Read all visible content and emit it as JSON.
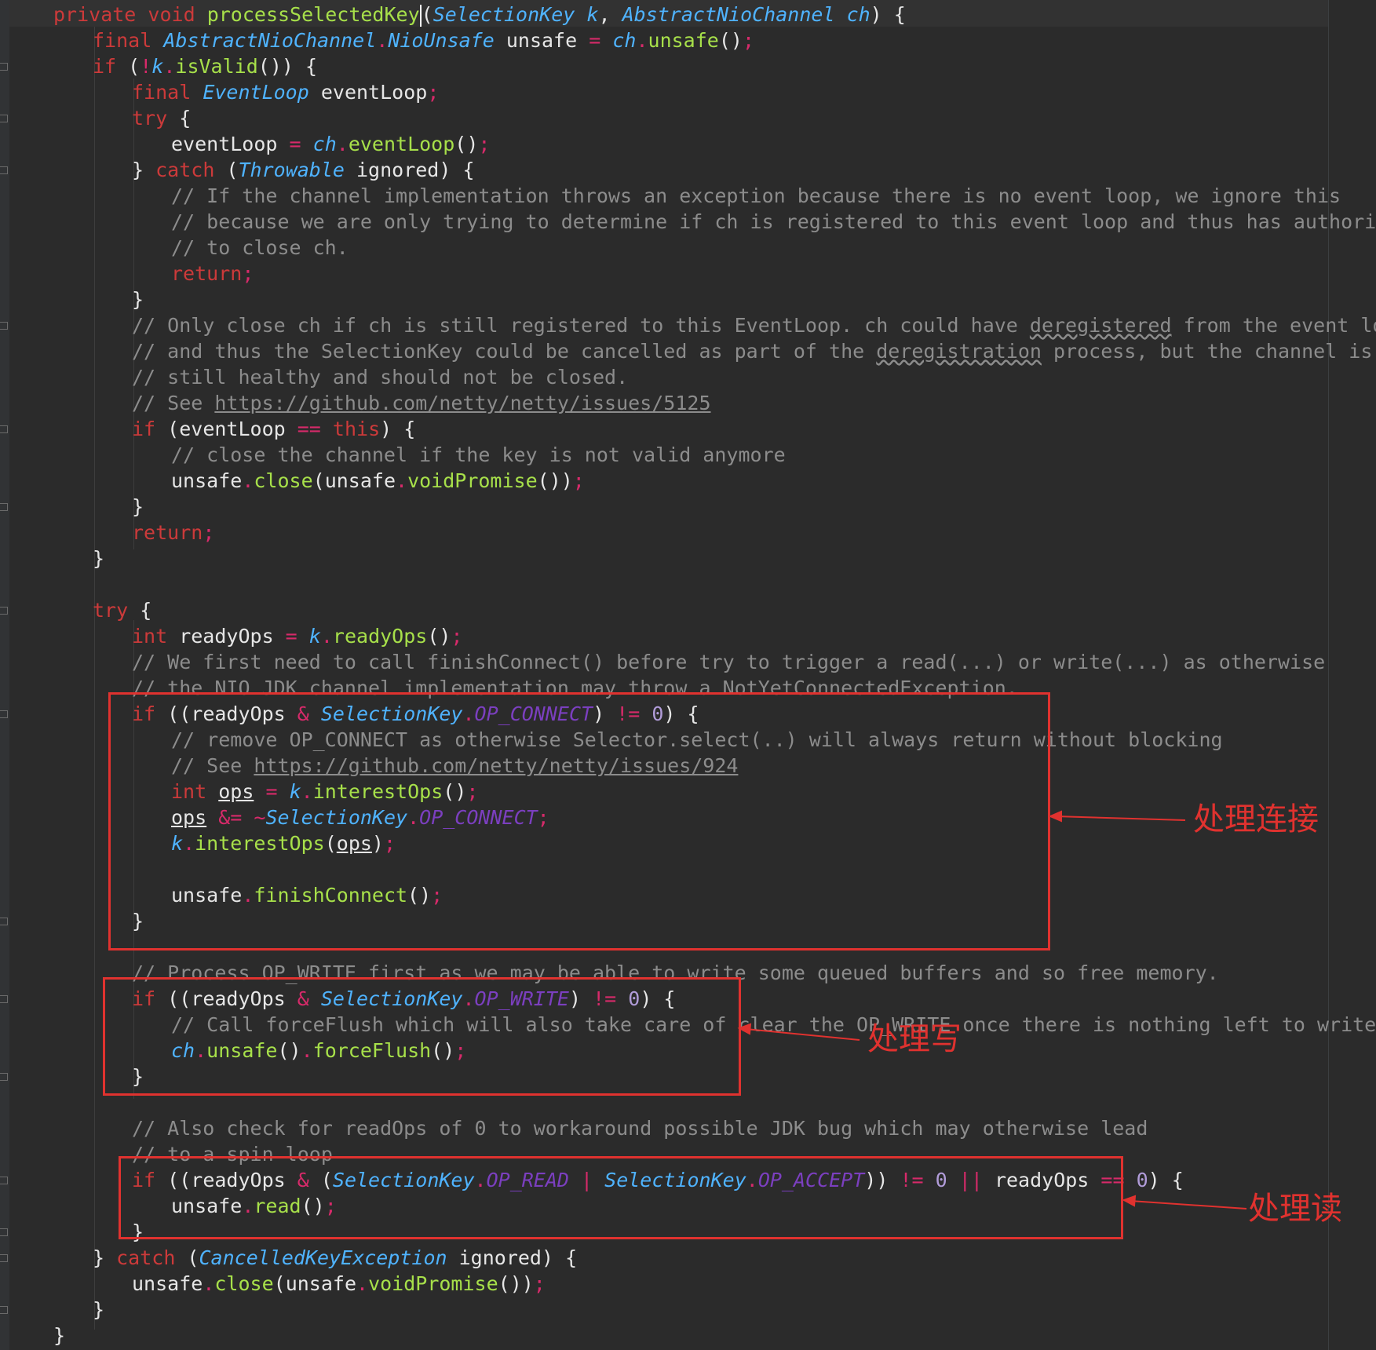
{
  "editor": {
    "lines": [
      [
        "private void processSelectedKey(SelectionKey k, AbstractNioChannel ch) {"
      ],
      [
        "final AbstractNioChannel.NioUnsafe unsafe = ch.unsafe();"
      ],
      [
        "if (!k.isValid()) {"
      ],
      [
        "final EventLoop eventLoop;"
      ],
      [
        "try {"
      ],
      [
        "eventLoop = ch.eventLoop();"
      ],
      [
        "} catch (Throwable ignored) {"
      ],
      [
        "// If the channel implementation throws an exception because there is no event loop, we ignore this"
      ],
      [
        "// because we are only trying to determine if ch is registered to this event loop and thus has authority"
      ],
      [
        "// to close ch."
      ],
      [
        "return;"
      ],
      [
        "}"
      ],
      [
        "// Only close ch if ch is still registered to this EventLoop. ch could have deregistered from the event loop"
      ],
      [
        "// and thus the SelectionKey could be cancelled as part of the deregistration process, but the channel is"
      ],
      [
        "// still healthy and should not be closed."
      ],
      [
        "// See https://github.com/netty/netty/issues/5125"
      ],
      [
        "if (eventLoop == this) {"
      ],
      [
        "// close the channel if the key is not valid anymore"
      ],
      [
        "unsafe.close(unsafe.voidPromise());"
      ],
      [
        "}"
      ],
      [
        "return;"
      ],
      [
        "}"
      ],
      [
        ""
      ],
      [
        "try {"
      ],
      [
        "int readyOps = k.readyOps();"
      ],
      [
        "// We first need to call finishConnect() before try to trigger a read(...) or write(...) as otherwise"
      ],
      [
        "// the NIO JDK channel implementation may throw a NotYetConnectedException."
      ],
      [
        "if ((readyOps & SelectionKey.OP_CONNECT) != 0) {"
      ],
      [
        "// remove OP_CONNECT as otherwise Selector.select(..) will always return without blocking"
      ],
      [
        "// See https://github.com/netty/netty/issues/924"
      ],
      [
        "int ops = k.interestOps();"
      ],
      [
        "ops &= ~SelectionKey.OP_CONNECT;"
      ],
      [
        "k.interestOps(ops);"
      ],
      [
        ""
      ],
      [
        "unsafe.finishConnect();"
      ],
      [
        "}"
      ],
      [
        ""
      ],
      [
        "// Process OP_WRITE first as we may be able to write some queued buffers and so free memory."
      ],
      [
        "if ((readyOps & SelectionKey.OP_WRITE) != 0) {"
      ],
      [
        "// Call forceFlush which will also take care of clear the OP_WRITE once there is nothing left to write"
      ],
      [
        "ch.unsafe().forceFlush();"
      ],
      [
        "}"
      ],
      [
        ""
      ],
      [
        "// Also check for readOps of 0 to workaround possible JDK bug which may otherwise lead"
      ],
      [
        "// to a spin loop"
      ],
      [
        "if ((readyOps & (SelectionKey.OP_READ | SelectionKey.OP_ACCEPT)) != 0 || readyOps == 0) {"
      ],
      [
        "unsafe.read();"
      ],
      [
        "}"
      ],
      [
        "} catch (CancelledKeyException ignored) {"
      ],
      [
        "unsafe.close(unsafe.voidPromise());"
      ],
      [
        "}"
      ],
      [
        "}"
      ]
    ]
  },
  "annotations": {
    "connect": "处理连接",
    "write": "处理写",
    "read": "处理读"
  },
  "colors": {
    "background": "#2b2b2b",
    "annotation": "#e0322f",
    "keyword": "#cc3a3a",
    "type": "#4fb3ff",
    "method": "#a7e04a",
    "comment": "#8c8c8c",
    "constant": "#7b3fbf"
  }
}
